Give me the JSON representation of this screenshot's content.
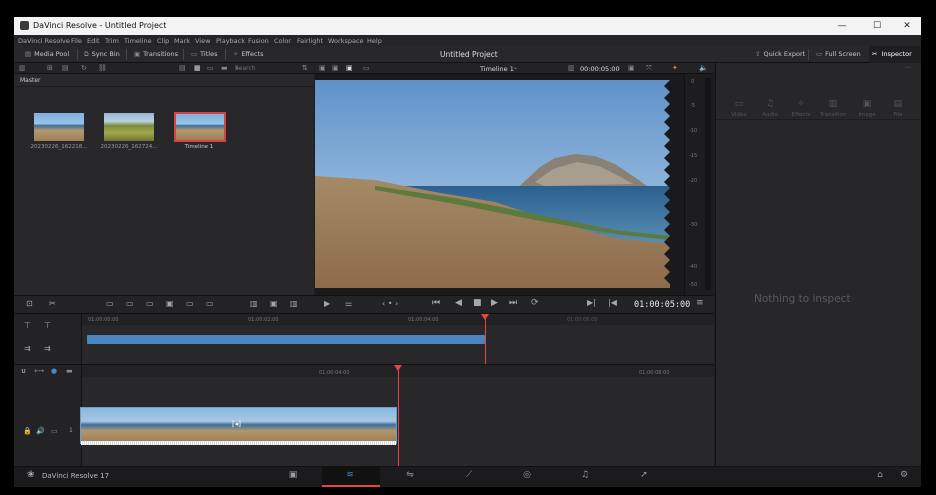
{
  "window": {
    "title": "DaVinci Resolve - Untitled Project",
    "controls": [
      "—",
      "☐",
      "✕"
    ]
  },
  "menu": [
    "DaVinci Resolve",
    "File",
    "Edit",
    "Trim",
    "Timeline",
    "Clip",
    "Mark",
    "View",
    "Playback",
    "Fusion",
    "Color",
    "Fairlight",
    "Workspace",
    "Help"
  ],
  "toolbar": {
    "media_pool": "Media Pool",
    "sync_bin": "Sync Bin",
    "transitions": "Transitions",
    "titles": "Titles",
    "effects": "Effects",
    "project_title": "Untitled Project",
    "quick_export": "Quick Export",
    "full_screen": "Full Screen",
    "inspector": "Inspector"
  },
  "media_pool": {
    "search_placeholder": "Search",
    "bin": "Master",
    "clips": [
      {
        "name": "20230226_162218..."
      },
      {
        "name": "20230226_162724..."
      },
      {
        "name": "Timeline 1"
      }
    ]
  },
  "viewer": {
    "timeline_name": "Timeline 1",
    "top_timecode": "00:00:05:00",
    "current_timecode": "01:00:05:00"
  },
  "meter": {
    "labels": [
      "0",
      "-5",
      "-10",
      "-15",
      "-20",
      "-30",
      "-40",
      "-50"
    ]
  },
  "inspector": {
    "tabs": [
      "Video",
      "Audio",
      "Effects",
      "Transition",
      "Image",
      "File"
    ],
    "empty_message": "Nothing to inspect"
  },
  "timeline_upper": {
    "ticks": [
      "01:00:00:00",
      "01:00:02:00",
      "01:00:04:00",
      "01:00:06:00"
    ]
  },
  "timeline_lower": {
    "ticks": [
      "01:00:04:00",
      "01:00:08:00"
    ],
    "track_number": "1",
    "playhead_progress": 0.93
  },
  "bottom": {
    "app_version": "DaVinci Resolve 17",
    "pages": [
      "media",
      "cut",
      "edit",
      "fusion",
      "color",
      "fairlight",
      "deliver"
    ]
  },
  "colors": {
    "accent": "#e64545",
    "clip_bar": "#4a85c0",
    "background": "#1f1f22"
  }
}
